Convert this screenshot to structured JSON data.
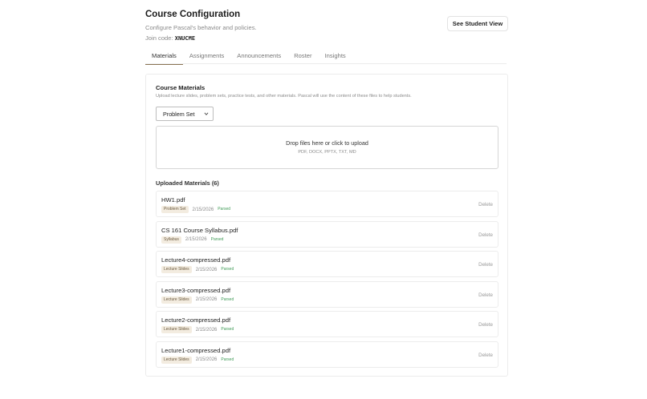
{
  "header": {
    "title": "Course Configuration",
    "subtitle": "Configure Pascal's behavior and policies.",
    "join_label": "Join code:",
    "join_code": "XNUCME",
    "student_view_label": "See Student View"
  },
  "tabs": [
    {
      "label": "Materials",
      "active": true
    },
    {
      "label": "Assignments",
      "active": false
    },
    {
      "label": "Announcements",
      "active": false
    },
    {
      "label": "Roster",
      "active": false
    },
    {
      "label": "Insights",
      "active": false
    }
  ],
  "materials": {
    "title": "Course Materials",
    "description": "Upload lecture slides, problem sets, practice tests, and other materials. Pascal will use the content of these files to help students.",
    "material_type_selected": "Problem Set",
    "dropzone_title": "Drop files here or click to upload",
    "dropzone_formats": "PDF, DOCX, PPTX, TXT, MD",
    "uploaded_title": "Uploaded Materials (6)",
    "delete_label": "Delete",
    "files": [
      {
        "name": "HW1.pdf",
        "tag": "Problem Set",
        "date": "2/15/2026",
        "status": "Parsed"
      },
      {
        "name": "CS 161 Course Syllabus.pdf",
        "tag": "Syllabus",
        "date": "2/15/2026",
        "status": "Parsed"
      },
      {
        "name": "Lecture4-compressed.pdf",
        "tag": "Lecture Slides",
        "date": "2/15/2026",
        "status": "Parsed"
      },
      {
        "name": "Lecture3-compressed.pdf",
        "tag": "Lecture Slides",
        "date": "2/15/2026",
        "status": "Parsed"
      },
      {
        "name": "Lecture2-compressed.pdf",
        "tag": "Lecture Slides",
        "date": "2/15/2026",
        "status": "Parsed"
      },
      {
        "name": "Lecture1-compressed.pdf",
        "tag": "Lecture Slides",
        "date": "2/15/2026",
        "status": "Parsed"
      }
    ]
  },
  "colors": {
    "accent": "#8a7454",
    "tag_bg": "#f3ece0",
    "status_green": "#3f9a56"
  },
  "icons": {
    "select_chevron": "chevron-down-icon"
  }
}
